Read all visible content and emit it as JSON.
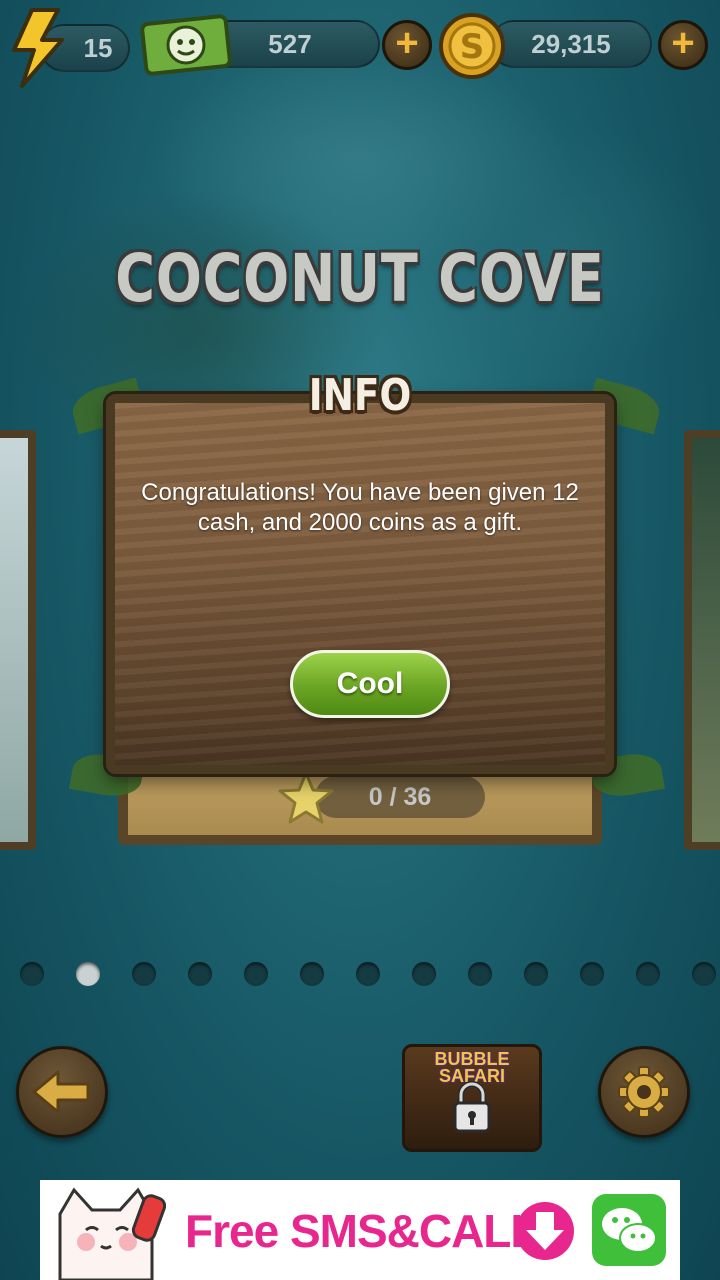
{
  "top_bar": {
    "energy_value": "15",
    "cash_value": "527",
    "coins_value": "29,315",
    "plus_label": "+"
  },
  "level": {
    "name": "COCONUT COVE",
    "stars_progress": "0 / 36"
  },
  "dialog": {
    "title": "INFO",
    "message": "Congratulations! You have been given 12 cash, and 2000 coins as a gift.",
    "button_label": "Cool"
  },
  "pagination": {
    "total_dots": 13,
    "active_index": 1
  },
  "bottom": {
    "back_icon": "arrow-left-icon",
    "settings_icon": "gear-icon",
    "locked_game_title": "BUBBLE SAFARI",
    "lock_icon": "lock-icon"
  },
  "ad": {
    "text": "Free SMS&CALL"
  },
  "colors": {
    "accent_gold": "#f2b83a",
    "button_green": "#6ba524",
    "ad_pink": "#e8278e"
  }
}
